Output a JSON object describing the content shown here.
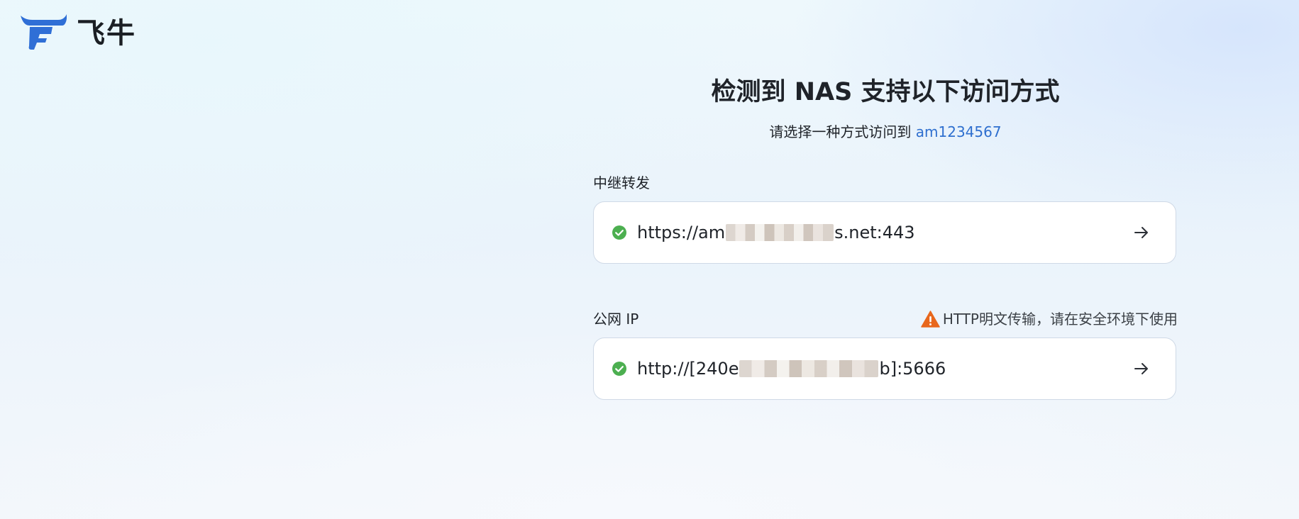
{
  "brand": {
    "name": "飞牛",
    "logo_color": "#2f6fd6"
  },
  "page": {
    "title": "检测到 NAS 支持以下访问方式",
    "subtitle_prefix": "请选择一种方式访问到",
    "device_name": "am1234567"
  },
  "methods": [
    {
      "label": "中继转发",
      "url_start": "https://am",
      "url_end": "s.net:443",
      "status_icon": "check-circle-icon",
      "action_icon": "arrow-right-icon"
    },
    {
      "label": "公网 IP",
      "warning": "HTTP明文传输，请在安全环境下使用",
      "warning_icon": "warning-triangle-icon",
      "url_start": "http://[240e",
      "url_end": "b]:5666",
      "status_icon": "check-circle-icon",
      "action_icon": "arrow-right-icon"
    }
  ],
  "colors": {
    "accent": "#2e6fcf",
    "success": "#4caf50",
    "warning": "#e8671c"
  }
}
